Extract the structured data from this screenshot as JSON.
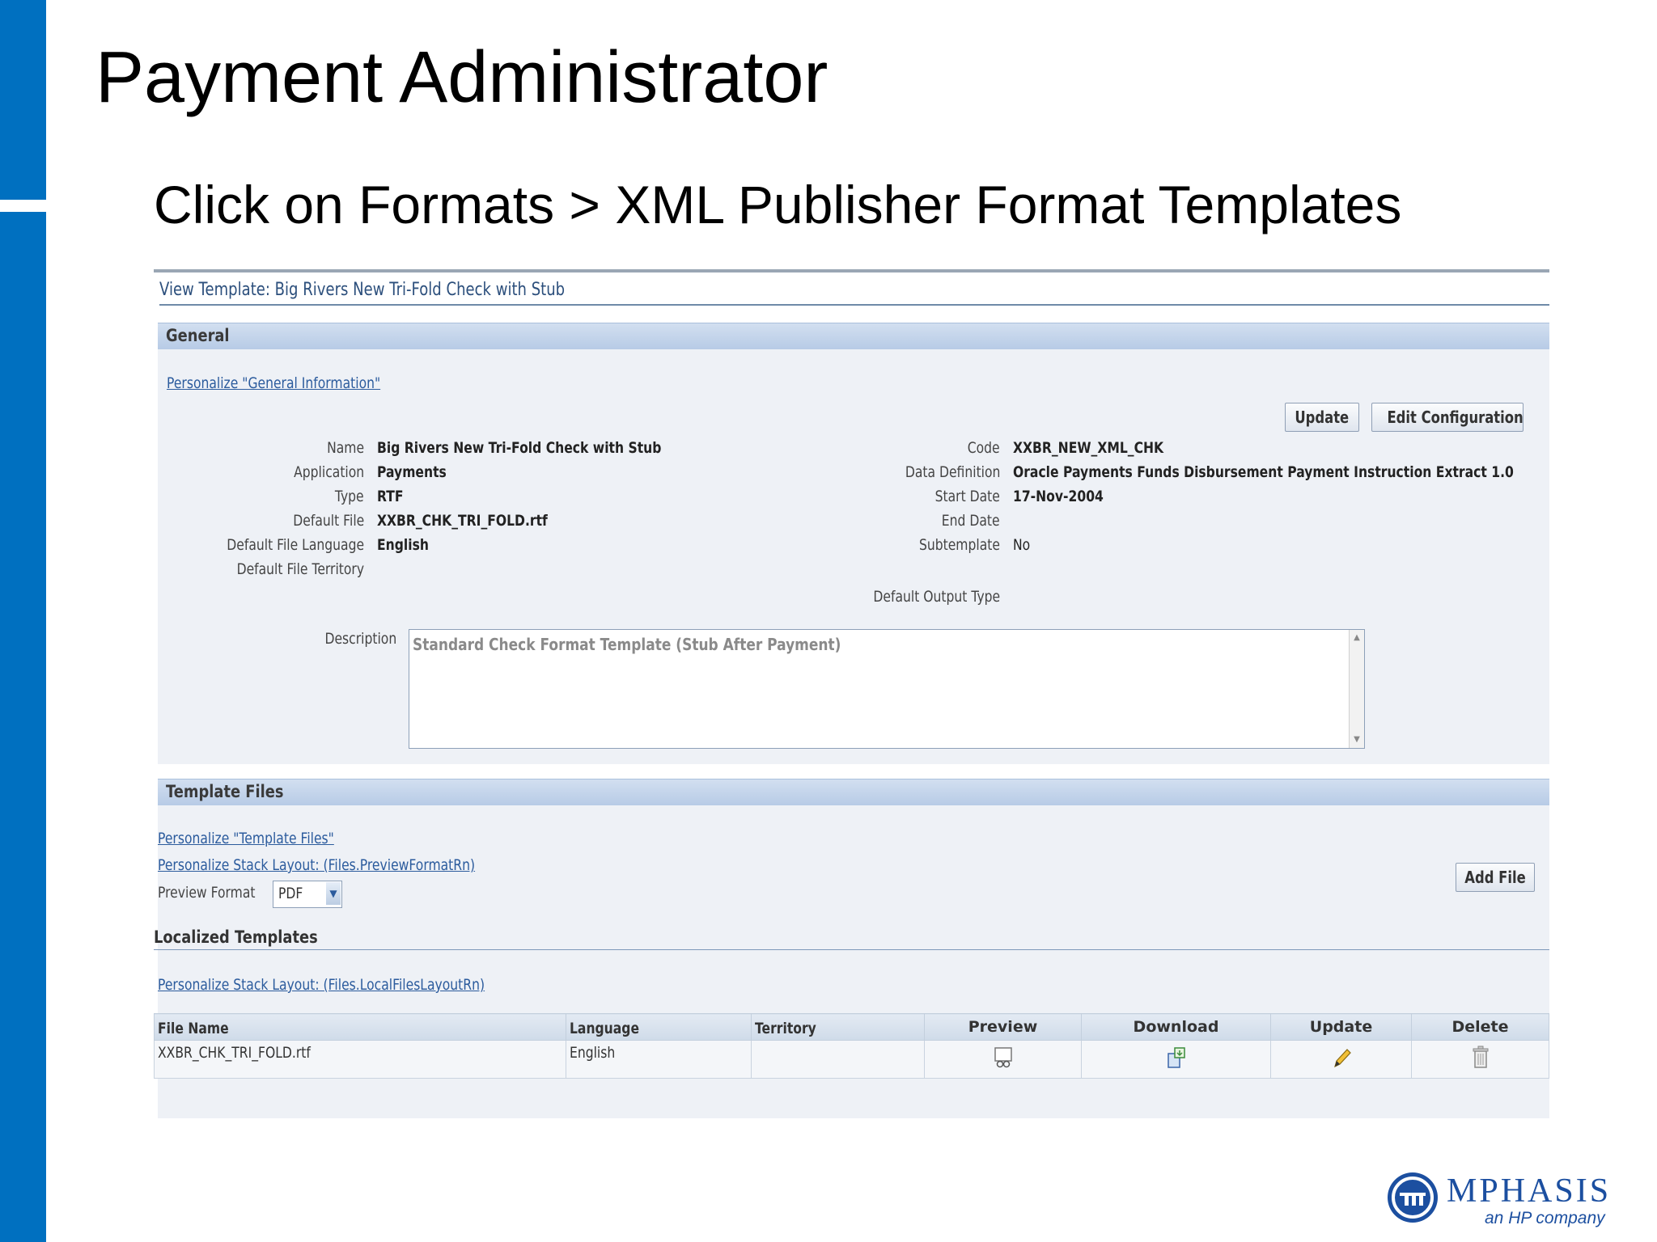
{
  "slide": {
    "title": "Payment Administrator",
    "subtitle": "Click on Formats > XML Publisher Format Templates"
  },
  "page": {
    "view_title": "View Template: Big Rivers New Tri-Fold Check with Stub"
  },
  "general": {
    "header": "General",
    "personalize_link": "Personalize \"General Information\"",
    "update_button": "Update",
    "edit_config_button": "Edit Configuration",
    "fields": {
      "name_label": "Name",
      "name_value": "Big Rivers New Tri-Fold Check with Stub",
      "application_label": "Application",
      "application_value": "Payments",
      "type_label": "Type",
      "type_value": "RTF",
      "default_file_label": "Default File",
      "default_file_value": "XXBR_CHK_TRI_FOLD.rtf",
      "default_file_language_label": "Default File Language",
      "default_file_language_value": "English",
      "default_file_territory_label": "Default File Territory",
      "code_label": "Code",
      "code_value": "XXBR_NEW_XML_CHK",
      "data_definition_label": "Data Definition",
      "data_definition_value": "Oracle Payments Funds Disbursement Payment Instruction Extract 1.0",
      "start_date_label": "Start Date",
      "start_date_value": "17-Nov-2004",
      "end_date_label": "End Date",
      "subtemplate_label": "Subtemplate",
      "subtemplate_value": "No",
      "default_output_type_label": "Default Output Type"
    },
    "description_label": "Description",
    "description_value": "Standard Check Format Template (Stub After Payment)"
  },
  "template_files": {
    "header": "Template Files",
    "personalize_link": "Personalize \"Template Files\"",
    "stack_layout_link": "Personalize Stack Layout: (Files.PreviewFormatRn)",
    "preview_format_label": "Preview Format",
    "preview_format_value": "PDF",
    "add_file_button": "Add File",
    "localized_title": "Localized Templates",
    "local_stack_link": "Personalize Stack Layout: (Files.LocalFilesLayoutRn)",
    "columns": [
      "File Name",
      "Language",
      "Territory",
      "Preview",
      "Download",
      "Update",
      "Delete"
    ],
    "rows": [
      {
        "file_name": "XXBR_CHK_TRI_FOLD.rtf",
        "language": "English",
        "territory": ""
      }
    ]
  },
  "logo": {
    "name": "MPHASIS",
    "tagline": "an HP company"
  },
  "colors": {
    "accent_bar": "#0070c0",
    "link": "#2b5b9d",
    "logo": "#1c4fa0"
  }
}
